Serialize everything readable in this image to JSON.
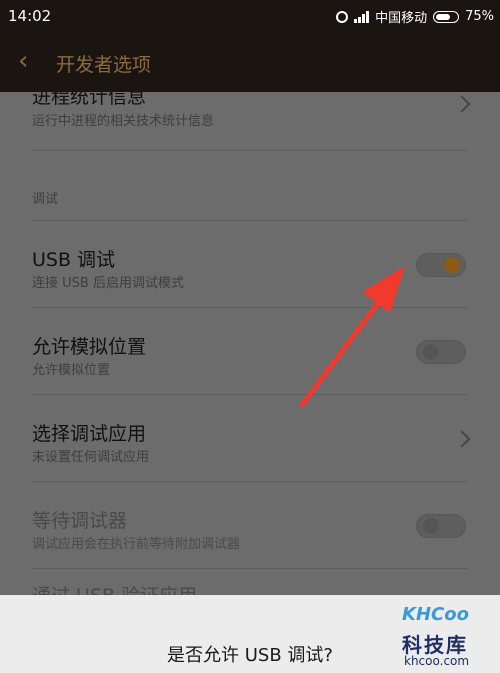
{
  "status_bar": {
    "time": "14:02",
    "carrier": "中国移动",
    "battery_text": "75%",
    "battery_level": 0.75,
    "icons": [
      "alarm-icon",
      "signal-icon",
      "battery-icon"
    ]
  },
  "header": {
    "title": "开发者选项",
    "back_icon": "chevron-left-icon"
  },
  "settings": {
    "process_stats": {
      "title": "进程统计信息",
      "subtitle": "运行中进程的相关技术统计信息"
    },
    "section_debug": "调试",
    "usb_debugging": {
      "title": "USB 调试",
      "subtitle": "连接 USB 后启用调试模式",
      "enabled": true
    },
    "mock_location": {
      "title": "允许模拟位置",
      "subtitle": "允许模拟位置",
      "enabled": false
    },
    "select_debug_app": {
      "title": "选择调试应用",
      "subtitle": "未设置任何调试应用"
    },
    "wait_for_debugger": {
      "title": "等待调试器",
      "subtitle": "调试应用会在执行前等待附加调试器",
      "enabled": false
    },
    "verify_usb_apps": {
      "title": "通过 USB 验证应用"
    }
  },
  "dialog": {
    "title": "是否允许 USB 调试?"
  },
  "watermark": {
    "logo": "KHCoo",
    "name": "科技库",
    "url": "khcoo.com"
  },
  "colors": {
    "accent": "#8b5a14",
    "header_bg": "#1b1512",
    "header_text": "#8a6a3e",
    "dim_overlay_bg": "#6c6c6c",
    "arrow": "#f03a2e"
  }
}
